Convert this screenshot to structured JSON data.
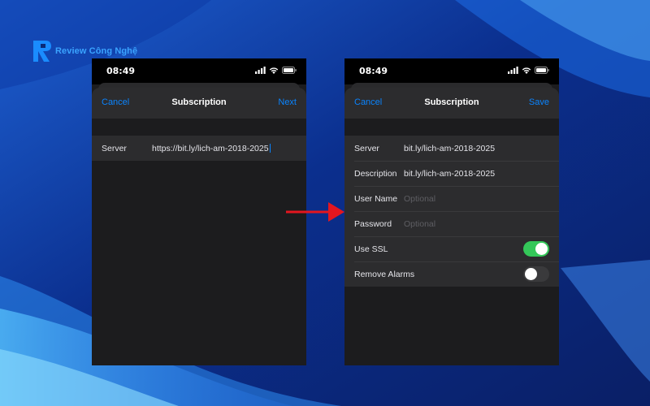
{
  "brand": {
    "name": "Review Công Nghệ",
    "accent": "#3aa3ff"
  },
  "colors": {
    "link": "#0a84ff",
    "toggle_on": "#34c759",
    "toggle_off": "#3a3a3c",
    "arrow": "#e3161f"
  },
  "left_phone": {
    "time": "08:49",
    "nav": {
      "cancel": "Cancel",
      "title": "Subscription",
      "next": "Next"
    },
    "server_label": "Server",
    "server_value": "https://bit.ly/lich-am-2018-2025"
  },
  "right_phone": {
    "time": "08:49",
    "nav": {
      "cancel": "Cancel",
      "title": "Subscription",
      "save": "Save"
    },
    "rows": [
      {
        "label": "Server",
        "value": "bit.ly/lich-am-2018-2025"
      },
      {
        "label": "Description",
        "value": "bit.ly/lich-am-2018-2025"
      },
      {
        "label": "User Name",
        "placeholder": "Optional"
      },
      {
        "label": "Password",
        "placeholder": "Optional"
      }
    ],
    "use_ssl": {
      "label": "Use SSL",
      "on": true
    },
    "remove_alarms": {
      "label": "Remove Alarms",
      "on": false
    }
  }
}
